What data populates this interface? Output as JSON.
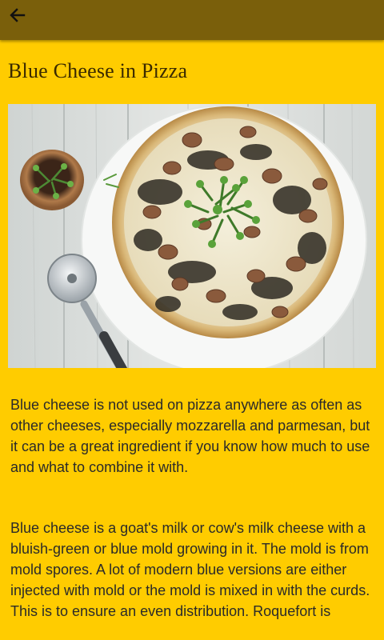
{
  "header": {
    "back_icon": "arrow-back-icon",
    "bar_color": "#7A5F0B"
  },
  "page": {
    "background": "#FFCC00",
    "title": "Blue Cheese in Pizza",
    "image_subject": "blue cheese mushroom pizza with pizza cutter",
    "paragraphs": [
      "Blue cheese is not used on pizza anywhere as often as other cheeses, especially mozzarella and parmesan, but it can be a great ingredient if you know how much to use and what to combine it with.",
      "Blue cheese is a goat's milk or cow's milk cheese with a bluish-green or blue mold growing in it. The mold is from mold spores. A lot of modern blue versions are either injected with mold or the mold is mixed in with the curds. This is to ensure an even distribution. Roquefort is"
    ]
  }
}
